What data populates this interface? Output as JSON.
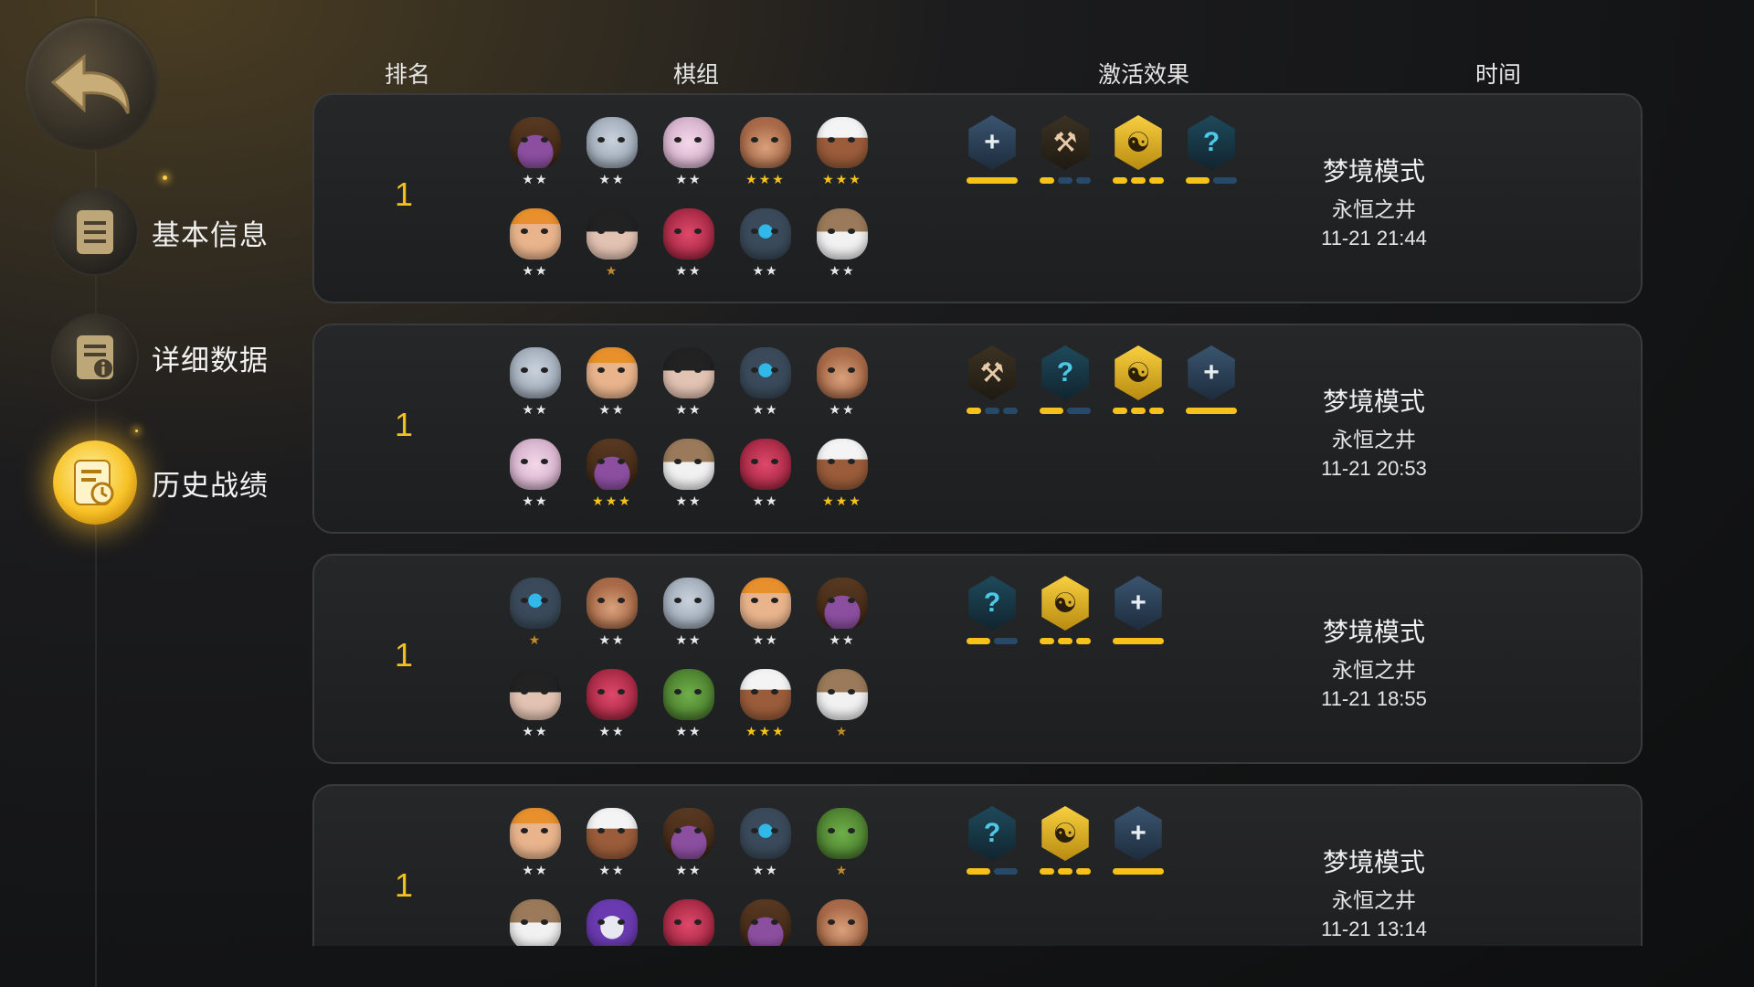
{
  "sidebar": {
    "back_icon": "return-arrow-icon",
    "items": [
      {
        "label": "基本信息",
        "icon": "document-icon",
        "active": false
      },
      {
        "label": "详细数据",
        "icon": "info-document-icon",
        "active": false
      },
      {
        "label": "历史战绩",
        "icon": "history-clock-icon",
        "active": true
      }
    ]
  },
  "columns": {
    "rank": "排名",
    "team": "棋组",
    "effects": "激活效果",
    "time": "时间"
  },
  "colors": {
    "accent": "#f3c21c",
    "bar_on": "#f6c21a",
    "bar_off": "#274a6a"
  },
  "matches": [
    {
      "rank": "1",
      "heroes": [
        {
          "face": "bull",
          "stars": 2
        },
        {
          "face": "elephant",
          "stars": 2
        },
        {
          "face": "pig",
          "stars": 2
        },
        {
          "face": "old-scar",
          "stars": 3
        },
        {
          "face": "turban",
          "stars": 3
        },
        {
          "face": "feather",
          "stars": 2
        },
        {
          "face": "dark-hair",
          "stars": 1
        },
        {
          "face": "red-demon",
          "stars": 2
        },
        {
          "face": "blue-gem",
          "stars": 2
        },
        {
          "face": "white-beard",
          "stars": 2
        }
      ],
      "effects": [
        {
          "icon": "cross-icon",
          "on": 1,
          "total": 1
        },
        {
          "icon": "axe-icon",
          "on": 1,
          "total": 3
        },
        {
          "icon": "yin-icon",
          "on": 3,
          "total": 3
        },
        {
          "icon": "question-icon",
          "on": 1,
          "total": 2
        }
      ],
      "mode": "梦境模式",
      "map": "永恒之井",
      "time": "11-21 21:44"
    },
    {
      "rank": "1",
      "heroes": [
        {
          "face": "elephant",
          "stars": 2
        },
        {
          "face": "feather",
          "stars": 2
        },
        {
          "face": "dark-hair",
          "stars": 2
        },
        {
          "face": "blue-gem",
          "stars": 2
        },
        {
          "face": "old-scar",
          "stars": 2
        },
        {
          "face": "pig",
          "stars": 2
        },
        {
          "face": "bull",
          "stars": 3
        },
        {
          "face": "white-beard",
          "stars": 2
        },
        {
          "face": "red-demon",
          "stars": 2
        },
        {
          "face": "turban",
          "stars": 3
        }
      ],
      "effects": [
        {
          "icon": "axe-icon",
          "on": 1,
          "total": 3
        },
        {
          "icon": "question-icon",
          "on": 1,
          "total": 2
        },
        {
          "icon": "yin-icon",
          "on": 3,
          "total": 3
        },
        {
          "icon": "cross-icon",
          "on": 1,
          "total": 1
        }
      ],
      "mode": "梦境模式",
      "map": "永恒之井",
      "time": "11-21 20:53"
    },
    {
      "rank": "1",
      "heroes": [
        {
          "face": "blue-gem",
          "stars": 1
        },
        {
          "face": "old-scar",
          "stars": 2
        },
        {
          "face": "elephant",
          "stars": 2
        },
        {
          "face": "feather",
          "stars": 2
        },
        {
          "face": "bull",
          "stars": 2
        },
        {
          "face": "dark-hair",
          "stars": 2
        },
        {
          "face": "red-demon",
          "stars": 2
        },
        {
          "face": "green-orc",
          "stars": 2
        },
        {
          "face": "turban",
          "stars": 3
        },
        {
          "face": "white-beard",
          "stars": 1
        }
      ],
      "effects": [
        {
          "icon": "question-icon",
          "on": 1,
          "total": 2
        },
        {
          "icon": "yin-icon",
          "on": 3,
          "total": 3
        },
        {
          "icon": "cross-icon",
          "on": 1,
          "total": 1
        }
      ],
      "mode": "梦境模式",
      "map": "永恒之井",
      "time": "11-21 18:55"
    },
    {
      "rank": "1",
      "heroes": [
        {
          "face": "feather",
          "stars": 2
        },
        {
          "face": "turban",
          "stars": 2
        },
        {
          "face": "bull",
          "stars": 2
        },
        {
          "face": "blue-gem",
          "stars": 2
        },
        {
          "face": "green-orc",
          "stars": 1
        },
        {
          "face": "white-beard",
          "stars": 0
        },
        {
          "face": "purple-skull",
          "stars": 0
        },
        {
          "face": "red-demon",
          "stars": 0
        },
        {
          "face": "bull",
          "stars": 0
        },
        {
          "face": "old-scar",
          "stars": 0
        }
      ],
      "effects": [
        {
          "icon": "question-icon",
          "on": 1,
          "total": 2
        },
        {
          "icon": "yin-icon",
          "on": 3,
          "total": 3
        },
        {
          "icon": "cross-icon",
          "on": 1,
          "total": 1
        }
      ],
      "mode": "梦境模式",
      "map": "永恒之井",
      "time": "11-21 13:14"
    }
  ]
}
